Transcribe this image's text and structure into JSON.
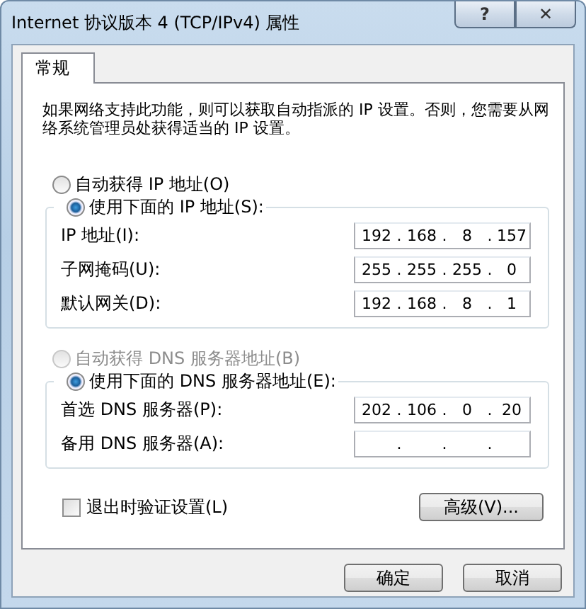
{
  "window": {
    "title": "Internet 协议版本 4 (TCP/IPv4) 属性",
    "help": "?",
    "close": "✕"
  },
  "tabs": [
    {
      "label": "常规",
      "selected": true
    }
  ],
  "description": "如果网络支持此功能，则可以获取自动指派的 IP 设置。否则，您需要从网络系统管理员处获得适当的 IP 设置。",
  "octet_separator": ".",
  "ip": {
    "options": [
      {
        "label": "自动获得 IP 地址(O)",
        "selected": false,
        "disabled": false
      },
      {
        "label": "使用下面的 IP 地址(S):",
        "selected": true,
        "disabled": false
      }
    ],
    "fields": [
      {
        "label": "IP 地址(I):",
        "octets": [
          "192",
          "168",
          "8",
          "157"
        ]
      },
      {
        "label": "子网掩码(U):",
        "octets": [
          "255",
          "255",
          "255",
          "0"
        ]
      },
      {
        "label": "默认网关(D):",
        "octets": [
          "192",
          "168",
          "8",
          "1"
        ]
      }
    ]
  },
  "dns": {
    "options": [
      {
        "label": "自动获得 DNS 服务器地址(B)",
        "selected": false,
        "disabled": true
      },
      {
        "label": "使用下面的 DNS 服务器地址(E):",
        "selected": true,
        "disabled": false
      }
    ],
    "fields": [
      {
        "label": "首选 DNS 服务器(P):",
        "octets": [
          "202",
          "106",
          "0",
          "20"
        ]
      },
      {
        "label": "备用 DNS 服务器(A):"
      }
    ]
  },
  "validate_checkbox": {
    "label": "退出时验证设置(L)",
    "checked": false
  },
  "advanced_button": "高级(V)...",
  "buttons": [
    "确定",
    "取消"
  ]
}
